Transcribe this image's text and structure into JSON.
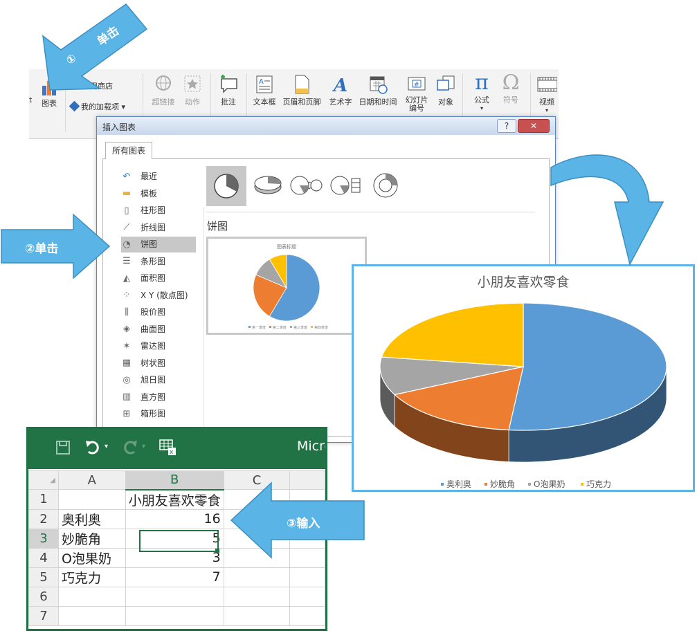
{
  "annotations": {
    "step1_circle": "①",
    "step1_label": "单击",
    "step2_label": "②单击",
    "step3_label": "③输入"
  },
  "ribbon": {
    "chart_label": "图表",
    "cut_label": "t",
    "app_store": "用商店",
    "my_addins": "我的加载项",
    "hyperlink": "超链接",
    "action": "动作",
    "comment": "批注",
    "textbox": "文本框",
    "header_footer": "页眉和页脚",
    "wordart": "艺术字",
    "datetime": "日期和时间",
    "slide_number": "幻灯片编号",
    "object": "对象",
    "equation": "公式",
    "symbol": "符号",
    "video": "视频"
  },
  "dialog": {
    "title": "插入图表",
    "help": "?",
    "close": "✕",
    "tab_all_charts": "所有图表",
    "categories": [
      {
        "label": "最近",
        "icon": "recent-icon"
      },
      {
        "label": "模板",
        "icon": "folder-icon"
      },
      {
        "label": "柱形图",
        "icon": "column-chart-icon"
      },
      {
        "label": "折线图",
        "icon": "line-chart-icon"
      },
      {
        "label": "饼图",
        "icon": "pie-chart-icon"
      },
      {
        "label": "条形图",
        "icon": "bar-chart-icon"
      },
      {
        "label": "面积图",
        "icon": "area-chart-icon"
      },
      {
        "label": "X Y (散点图)",
        "icon": "scatter-chart-icon"
      },
      {
        "label": "股价图",
        "icon": "stock-chart-icon"
      },
      {
        "label": "曲面图",
        "icon": "surface-chart-icon"
      },
      {
        "label": "雷达图",
        "icon": "radar-chart-icon"
      },
      {
        "label": "树状图",
        "icon": "treemap-chart-icon"
      },
      {
        "label": "旭日图",
        "icon": "sunburst-chart-icon"
      },
      {
        "label": "直方图",
        "icon": "histogram-chart-icon"
      },
      {
        "label": "箱形图",
        "icon": "boxplot-chart-icon"
      }
    ],
    "selected_category": "饼图",
    "subtype_heading": "饼图",
    "preview_title": "图表标题",
    "preview_legend": [
      "第一季度",
      "第二季度",
      "第三季度",
      "第四季度"
    ]
  },
  "chart_data": {
    "type": "pie",
    "title": "小朋友喜欢零食",
    "categories": [
      "奥利奥",
      "妙脆角",
      "O泡果奶",
      "巧克力"
    ],
    "values": [
      16,
      5,
      3,
      7
    ],
    "colors": [
      "#5b9bd5",
      "#ed7d31",
      "#a5a5a5",
      "#ffc000"
    ],
    "legend_position": "bottom"
  },
  "excel": {
    "app_title": "Micro",
    "columns": [
      "A",
      "B",
      "C"
    ],
    "header_title": "小朋友喜欢零食",
    "rows": [
      {
        "num": "1",
        "a": "",
        "b": "小朋友喜欢零食"
      },
      {
        "num": "2",
        "a": "奥利奥",
        "b": "16"
      },
      {
        "num": "3",
        "a": "妙脆角",
        "b": "5"
      },
      {
        "num": "4",
        "a": "O泡果奶",
        "b": "3"
      },
      {
        "num": "5",
        "a": "巧克力",
        "b": "7"
      },
      {
        "num": "6",
        "a": "",
        "b": ""
      },
      {
        "num": "7",
        "a": "",
        "b": ""
      }
    ]
  }
}
